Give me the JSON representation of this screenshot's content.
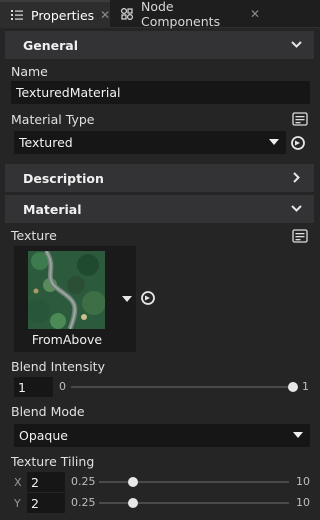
{
  "tabs": [
    {
      "label": "Properties",
      "icon": "list-icon",
      "active": true
    },
    {
      "label": "Node Components",
      "icon": "components-icon",
      "active": false
    }
  ],
  "general": {
    "title": "General",
    "name_label": "Name",
    "name_value": "TexturedMaterial",
    "material_type_label": "Material Type",
    "material_type_value": "Textured"
  },
  "description": {
    "title": "Description"
  },
  "material": {
    "title": "Material",
    "texture_label": "Texture",
    "texture_name": "FromAbove",
    "blend_intensity_label": "Blend Intensity",
    "blend_intensity_value": "1",
    "blend_intensity_min": "0",
    "blend_intensity_max": "1",
    "blend_intensity_fraction": 1.0,
    "blend_mode_label": "Blend Mode",
    "blend_mode_value": "Opaque",
    "texture_tiling_label": "Texture Tiling",
    "tiling": [
      {
        "axis": "X",
        "value": "2",
        "min": "0.25",
        "max": "10",
        "fraction": 0.18
      },
      {
        "axis": "Y",
        "value": "2",
        "min": "0.25",
        "max": "10",
        "fraction": 0.18
      }
    ]
  },
  "colors": {
    "background": "#252526",
    "section": "#333336",
    "field": "#161616",
    "text": "#e6e6e6"
  }
}
